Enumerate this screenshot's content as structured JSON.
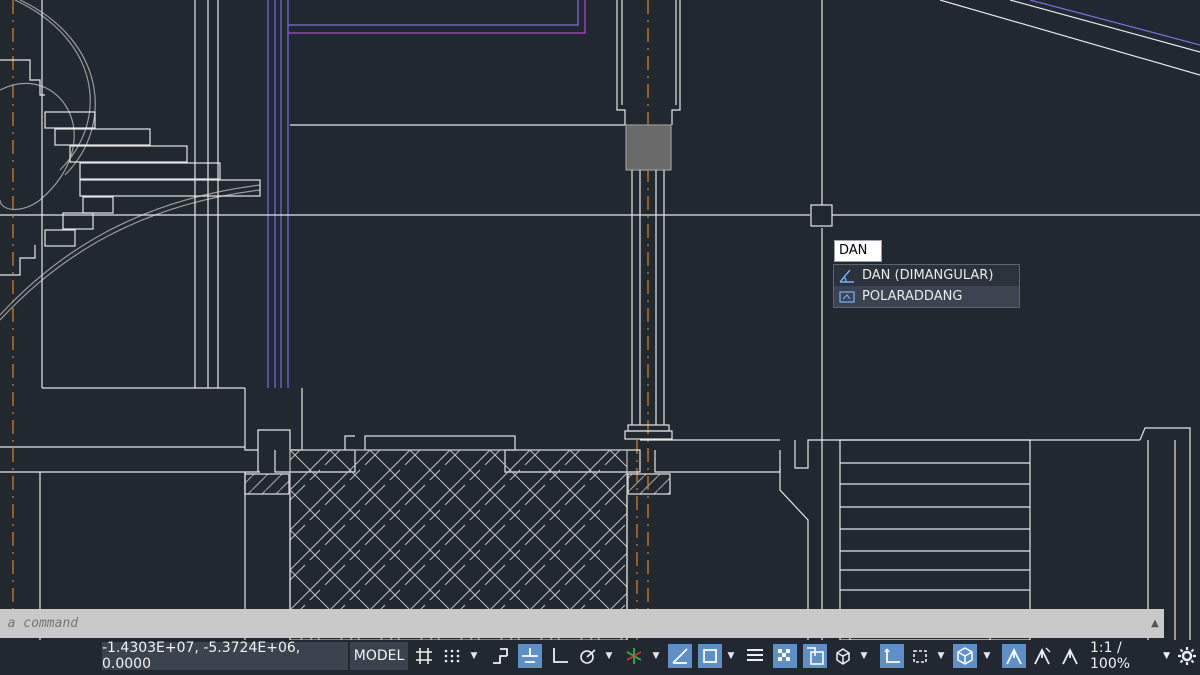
{
  "dynamic_input": {
    "value": "DAN"
  },
  "autocomplete": {
    "items": [
      {
        "label": "DAN (DIMANGULAR)",
        "icon": "dimangular-icon",
        "selected": false
      },
      {
        "label": "POLARADDANG",
        "icon": "polaraddang-icon",
        "selected": true
      }
    ]
  },
  "command_line": {
    "placeholder": "e a command"
  },
  "status_bar": {
    "coordinates": "-1.4303E+07, -5.3724E+06, 0.0000",
    "model_label": "MODEL",
    "annotation_scale": "1:1 / 100%",
    "toggles": [
      {
        "name": "grid-icon",
        "on": false
      },
      {
        "name": "snap-icon",
        "on": false
      },
      {
        "name": "infer-constraints-icon",
        "on": false
      },
      {
        "name": "dynamic-input-icon",
        "on": true
      },
      {
        "name": "ortho-icon",
        "on": false
      },
      {
        "name": "polar-tracking-icon",
        "on": false
      },
      {
        "name": "isometric-icon",
        "on": false
      },
      {
        "name": "object-snap-tracking-icon",
        "on": true
      },
      {
        "name": "object-snap-icon",
        "on": true
      },
      {
        "name": "lineweight-icon",
        "on": false
      },
      {
        "name": "transparency-icon",
        "on": true
      },
      {
        "name": "selection-cycling-icon",
        "on": true
      },
      {
        "name": "3d-object-snap-icon",
        "on": false
      },
      {
        "name": "dynamic-ucs-icon",
        "on": true
      },
      {
        "name": "selection-filter-icon",
        "on": false
      },
      {
        "name": "gizmo-icon",
        "on": true
      },
      {
        "name": "annotation-visibility-icon",
        "on": true
      },
      {
        "name": "auto-scale-icon",
        "on": false
      },
      {
        "name": "annotation-scale-icon",
        "on": false
      },
      {
        "name": "settings-gear-icon",
        "on": false
      }
    ]
  },
  "colors": {
    "background": "#212830",
    "linework": "#e8e8e8",
    "centerline": "#e0821e",
    "purple": "#8070e0",
    "magenta": "#c040d0",
    "toggle_on": "#5e8fc8"
  }
}
